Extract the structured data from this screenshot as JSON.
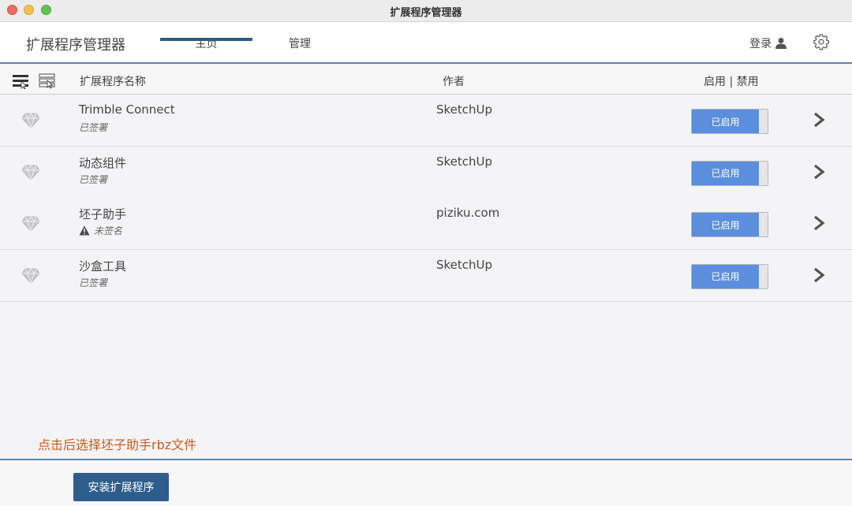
{
  "window": {
    "title": "扩展程序管理器"
  },
  "header": {
    "app_title": "扩展程序管理器",
    "tabs": [
      {
        "label": "主页",
        "active": true
      },
      {
        "label": "管理",
        "active": false
      }
    ],
    "login_label": "登录"
  },
  "columns": {
    "name": "扩展程序名称",
    "author": "作者",
    "status": "启用 | 禁用"
  },
  "extensions": [
    {
      "name": "Trimble Connect",
      "signature": "已签署",
      "signed": true,
      "author": "SketchUp",
      "toggle_label": "已启用",
      "enabled": true
    },
    {
      "name": "动态组件",
      "signature": "已签署",
      "signed": true,
      "author": "SketchUp",
      "toggle_label": "已启用",
      "enabled": true
    },
    {
      "name": "坯子助手",
      "signature": "未签名",
      "signed": false,
      "author": "piziku.com",
      "toggle_label": "已启用",
      "enabled": true
    },
    {
      "name": "沙盒工具",
      "signature": "已签署",
      "signed": true,
      "author": "SketchUp",
      "toggle_label": "已启用",
      "enabled": true
    }
  ],
  "annotation": "点击后选择坯子助手rbz文件",
  "footer": {
    "install_label": "安装扩展程序"
  },
  "colors": {
    "accent": "#2d5d8c",
    "toggle_on": "#5b8fde",
    "annotation": "#cc5a1e",
    "header_rule": "#5b86b0"
  },
  "icons": [
    "close-dot",
    "minimize-dot",
    "maximize-dot",
    "user-icon",
    "gear-icon",
    "list-view-icon",
    "detail-view-icon",
    "gem-icon",
    "warning-icon",
    "chevron-right-icon"
  ]
}
